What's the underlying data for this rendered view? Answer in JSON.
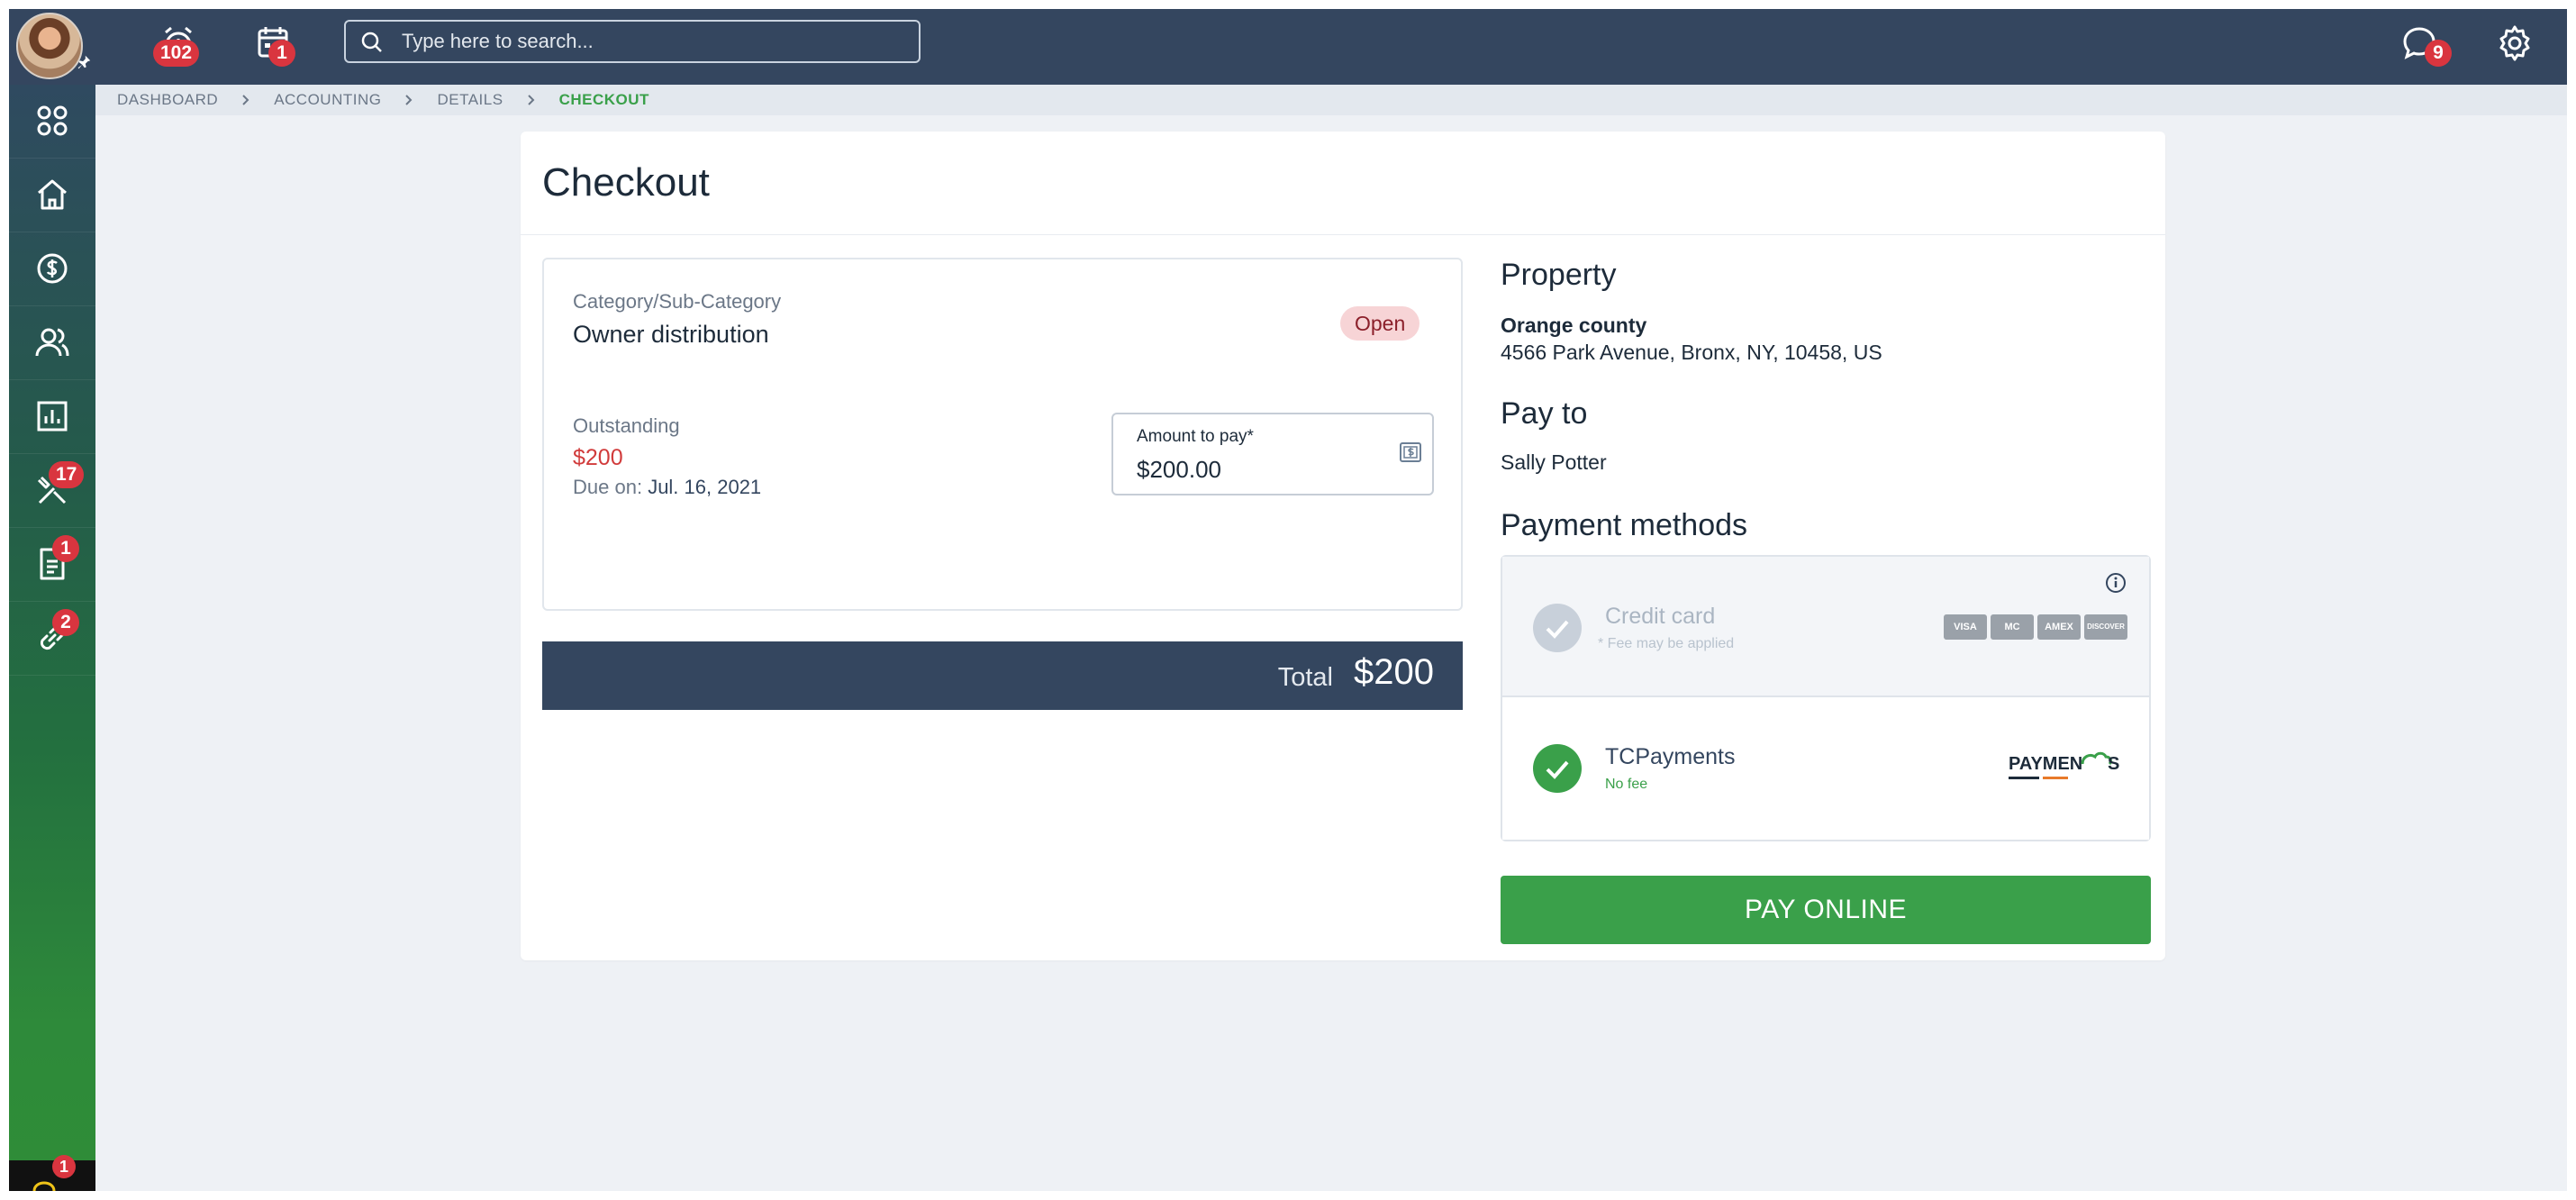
{
  "topbar": {
    "alerts_badge": "102",
    "calendar_badge": "1",
    "search_placeholder": "Type here to search...",
    "messages_badge": "9"
  },
  "sidebar": {
    "items": [
      {
        "icon": "apps-icon",
        "badge": ""
      },
      {
        "icon": "home-icon",
        "badge": ""
      },
      {
        "icon": "dollar-icon",
        "badge": ""
      },
      {
        "icon": "users-icon",
        "badge": ""
      },
      {
        "icon": "chart-icon",
        "badge": ""
      },
      {
        "icon": "tools-icon",
        "badge": "17"
      },
      {
        "icon": "document-icon",
        "badge": "1"
      },
      {
        "icon": "link-icon",
        "badge": "2"
      }
    ],
    "bottom_badge": "1"
  },
  "breadcrumb": [
    "DASHBOARD",
    "ACCOUNTING",
    "DETAILS",
    "CHECKOUT"
  ],
  "checkout": {
    "title": "Checkout",
    "bill": {
      "category_label": "Category/Sub-Category",
      "category_value": "Owner distribution",
      "status": "Open",
      "outstanding_label": "Outstanding",
      "outstanding_value": "$200",
      "due_label": "Due on:",
      "due_date": "Jul. 16, 2021",
      "amount_label": "Amount to pay*",
      "amount_value": "$200.00"
    },
    "total_label": "Total",
    "total_value": "$200",
    "property": {
      "title": "Property",
      "name": "Orange county",
      "address": "4566 Park Avenue, Bronx, NY, 10458, US"
    },
    "pay_to": {
      "title": "Pay to",
      "name": "Sally Potter"
    },
    "payment_methods": {
      "title": "Payment methods",
      "methods": [
        {
          "name": "Credit card",
          "note": "* Fee may be applied",
          "selected": false
        },
        {
          "name": "TCPayments",
          "note": "No fee",
          "selected": true
        }
      ],
      "card_brands": [
        "VISA",
        "MC",
        "AMEX",
        "DISCOVER"
      ]
    },
    "pay_button": "PAY ONLINE"
  },
  "colors": {
    "topbar": "#34465f",
    "accent_green": "#3aa04a",
    "badge_red": "#d9353f",
    "outstanding_red": "#d13b3b"
  }
}
